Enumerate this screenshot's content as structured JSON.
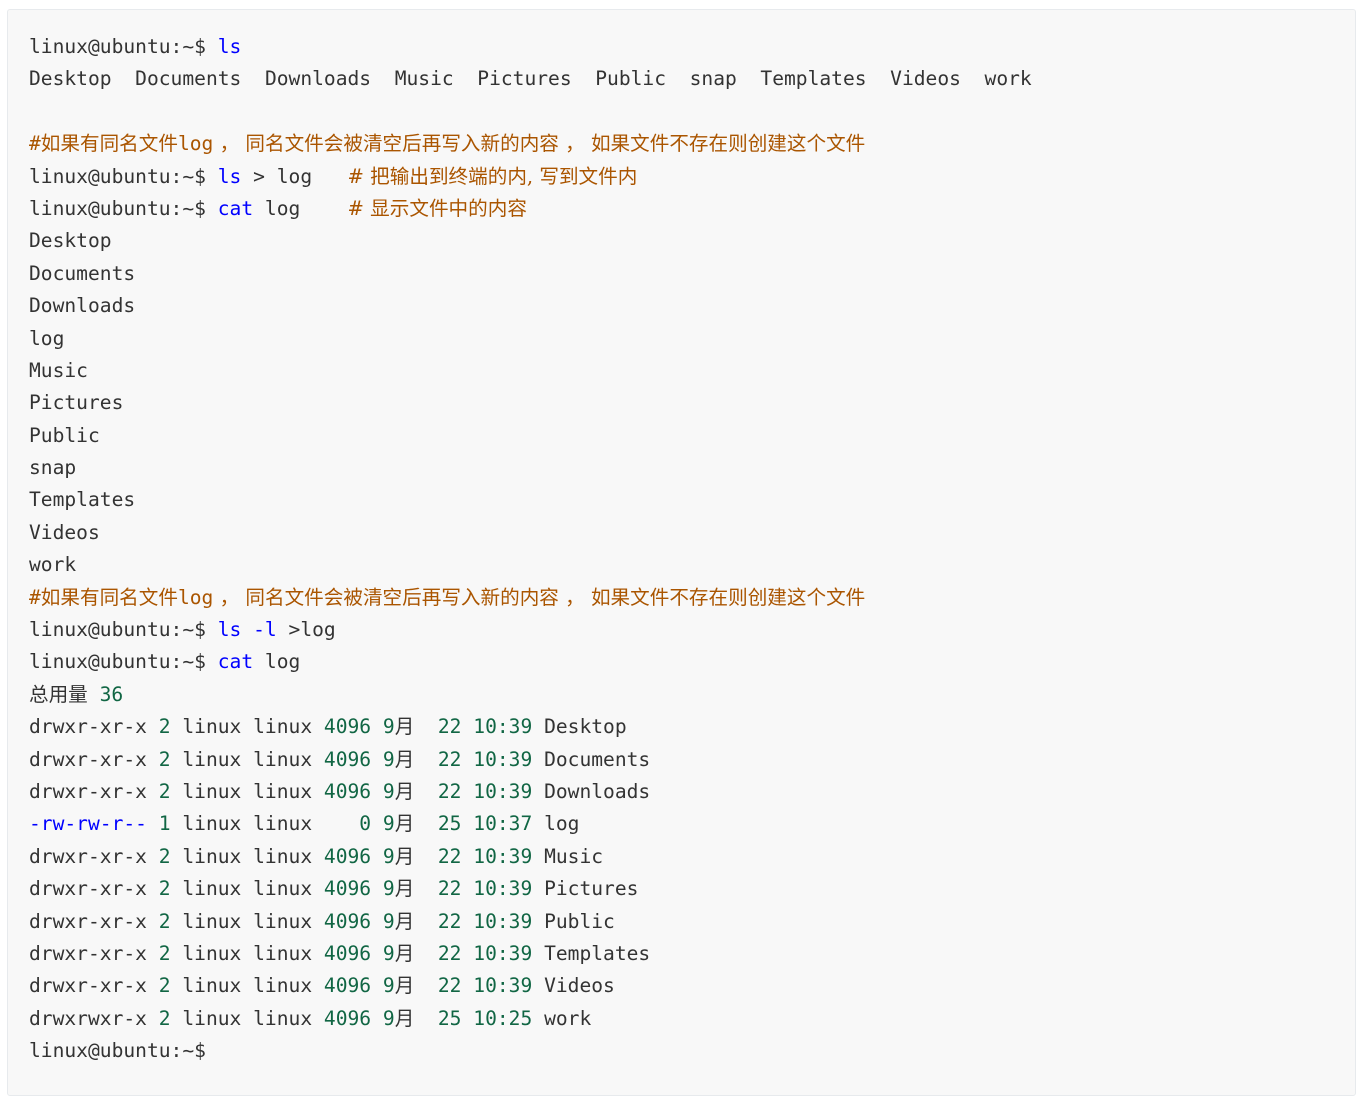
{
  "prompt": "linux@ubuntu:~$",
  "colors": {
    "background": "#f8f8f8",
    "text": "#333333",
    "keyword": "#0000ff",
    "number": "#116644",
    "comment": "#aa5500"
  },
  "cmd1": "ls",
  "ls_row": [
    "Desktop",
    "Documents",
    "Downloads",
    "Music",
    "Pictures",
    "Public",
    "snap",
    "Templates",
    "Videos",
    "work"
  ],
  "comment": {
    "hash": "#",
    "part1": "如果有同名文件",
    "log": "log",
    "part2": " ， 同名文件会被清空后再写入新的内容 ， 如果文件不存在则创建这个文件"
  },
  "cmd2": {
    "cmd": "ls",
    "rest": " > log   ",
    "comment": "# 把输出到终端的内, 写到文件内"
  },
  "cmd3": {
    "cmd": "cat",
    "rest": " log    ",
    "comment": "# 显示文件中的内容"
  },
  "cat_output": [
    "Desktop",
    "Documents",
    "Downloads",
    "log",
    "Music",
    "Pictures",
    "Public",
    "snap",
    "Templates",
    "Videos",
    "work"
  ],
  "cmd4": {
    "cmd": "ls",
    "flag": "-l",
    "rest": " >log"
  },
  "cmd5": {
    "cmd": "cat",
    "rest": " log"
  },
  "total": {
    "label": "总用量",
    "value": "36"
  },
  "listing": [
    {
      "perm": "drwxr-xr-x",
      "links": "2",
      "owner": "linux",
      "group": "linux",
      "size": "4096",
      "month_num": "9",
      "month_unit": "月",
      "day": "22",
      "time": "10:39",
      "name": "Desktop"
    },
    {
      "perm": "drwxr-xr-x",
      "links": "2",
      "owner": "linux",
      "group": "linux",
      "size": "4096",
      "month_num": "9",
      "month_unit": "月",
      "day": "22",
      "time": "10:39",
      "name": "Documents"
    },
    {
      "perm": "drwxr-xr-x",
      "links": "2",
      "owner": "linux",
      "group": "linux",
      "size": "4096",
      "month_num": "9",
      "month_unit": "月",
      "day": "22",
      "time": "10:39",
      "name": "Downloads"
    },
    {
      "perm": "-rw-rw-r--",
      "links": "1",
      "owner": "linux",
      "group": "linux",
      "size": "   0",
      "month_num": "9",
      "month_unit": "月",
      "day": "25",
      "time": "10:37",
      "name": "log"
    },
    {
      "perm": "drwxr-xr-x",
      "links": "2",
      "owner": "linux",
      "group": "linux",
      "size": "4096",
      "month_num": "9",
      "month_unit": "月",
      "day": "22",
      "time": "10:39",
      "name": "Music"
    },
    {
      "perm": "drwxr-xr-x",
      "links": "2",
      "owner": "linux",
      "group": "linux",
      "size": "4096",
      "month_num": "9",
      "month_unit": "月",
      "day": "22",
      "time": "10:39",
      "name": "Pictures"
    },
    {
      "perm": "drwxr-xr-x",
      "links": "2",
      "owner": "linux",
      "group": "linux",
      "size": "4096",
      "month_num": "9",
      "month_unit": "月",
      "day": "22",
      "time": "10:39",
      "name": "Public"
    },
    {
      "perm": "drwxr-xr-x",
      "links": "2",
      "owner": "linux",
      "group": "linux",
      "size": "4096",
      "month_num": "9",
      "month_unit": "月",
      "day": "22",
      "time": "10:39",
      "name": "Templates"
    },
    {
      "perm": "drwxr-xr-x",
      "links": "2",
      "owner": "linux",
      "group": "linux",
      "size": "4096",
      "month_num": "9",
      "month_unit": "月",
      "day": "22",
      "time": "10:39",
      "name": "Videos"
    },
    {
      "perm": "drwxrwxr-x",
      "links": "2",
      "owner": "linux",
      "group": "linux",
      "size": "4096",
      "month_num": "9",
      "month_unit": "月",
      "day": "25",
      "time": "10:25",
      "name": "work"
    }
  ]
}
